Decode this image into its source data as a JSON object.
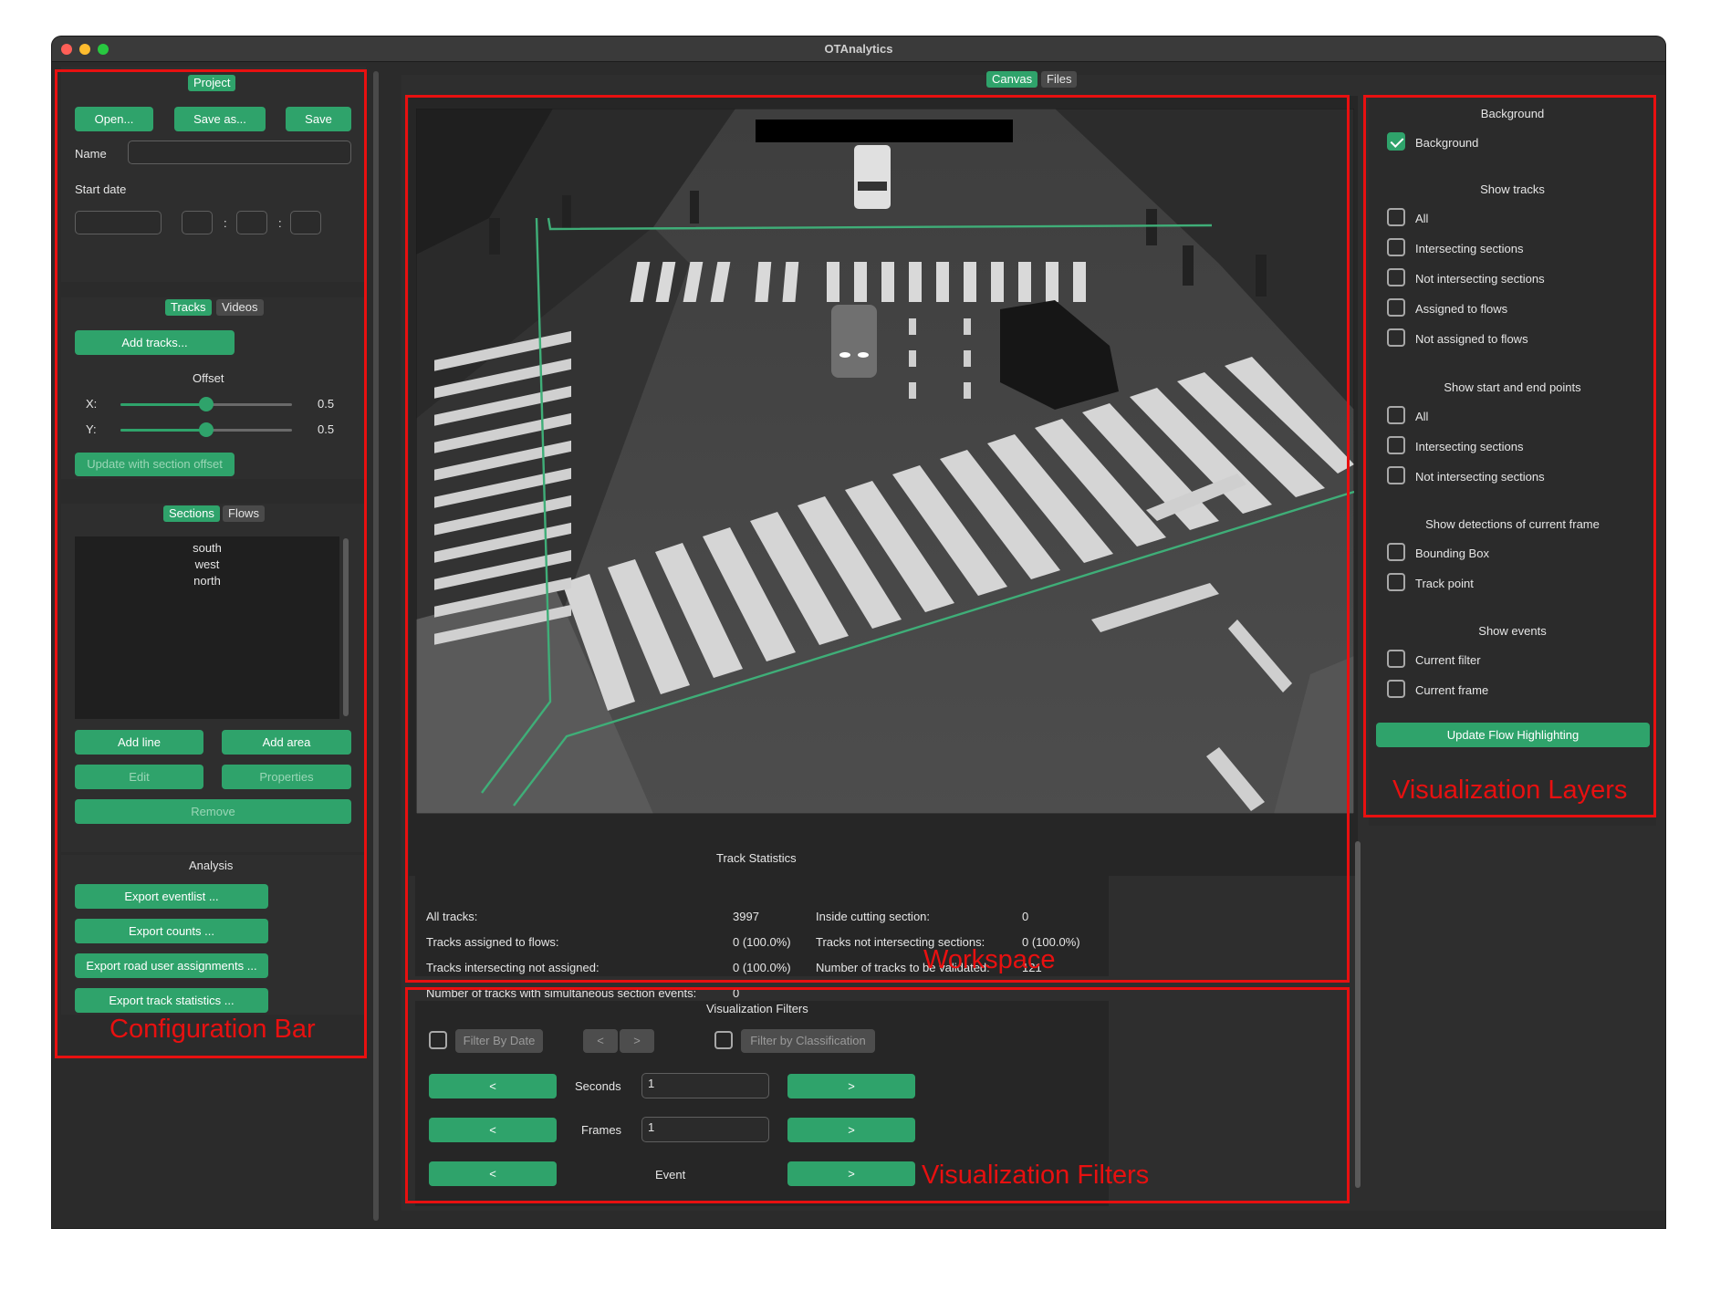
{
  "window": {
    "title": "OTAnalytics"
  },
  "config": {
    "project_tab": "Project",
    "open": "Open...",
    "save_as": "Save as...",
    "save": "Save",
    "name_label": "Name",
    "name_value": "",
    "start_date_label": "Start date",
    "time_sep1": ":",
    "time_sep2": ":",
    "tracks_tab": "Tracks",
    "videos_tab": "Videos",
    "add_tracks": "Add tracks...",
    "offset_label": "Offset",
    "x_label": "X:",
    "x_value": "0.5",
    "y_label": "Y:",
    "y_value": "0.5",
    "update_offset": "Update with section offset",
    "sections_tab": "Sections",
    "flows_tab": "Flows",
    "sections": [
      "south",
      "west",
      "north"
    ],
    "add_line": "Add line",
    "add_area": "Add area",
    "edit": "Edit",
    "properties": "Properties",
    "remove": "Remove",
    "analysis_title": "Analysis",
    "export_eventlist": "Export eventlist ...",
    "export_counts": "Export counts ...",
    "export_assignments": "Export road user assignments ...",
    "export_track_stats": "Export track statistics ..."
  },
  "workspace": {
    "canvas_tab": "Canvas",
    "files_tab": "Files",
    "stats_title": "Track Statistics",
    "stats_left": [
      {
        "label": "All tracks:",
        "value": "3997"
      },
      {
        "label": "Tracks assigned to flows:",
        "value": "0 (100.0%)"
      },
      {
        "label": "Tracks intersecting not assigned:",
        "value": "0 (100.0%)"
      },
      {
        "label": "Number of tracks with simultaneous section events:",
        "value": "0"
      }
    ],
    "stats_right": [
      {
        "label": "Inside cutting section:",
        "value": "0"
      },
      {
        "label": "Tracks not intersecting sections:",
        "value": "0 (100.0%)"
      },
      {
        "label": "Number of tracks to be validated:",
        "value": "121"
      }
    ]
  },
  "filters": {
    "title": "Visualization Filters",
    "filter_by_date": "Filter By Date",
    "prev_small": "<",
    "next_small": ">",
    "filter_by_classification": "Filter by Classification",
    "seconds_label": "Seconds",
    "seconds_value": "1",
    "frames_label": "Frames",
    "frames_value": "1",
    "event_label": "Event",
    "prev": "<",
    "next": ">"
  },
  "layers": {
    "background_title": "Background",
    "background_cb": "Background",
    "show_tracks_title": "Show tracks",
    "tracks": [
      "All",
      "Intersecting sections",
      "Not intersecting sections",
      "Assigned to flows",
      "Not assigned to flows"
    ],
    "start_end_title": "Show start and end points",
    "start_end": [
      "All",
      "Intersecting sections",
      "Not intersecting sections"
    ],
    "detections_title": "Show detections of current frame",
    "detections": [
      "Bounding Box",
      "Track point"
    ],
    "events_title": "Show events",
    "events": [
      "Current filter",
      "Current frame"
    ],
    "update_flow": "Update Flow Highlighting"
  },
  "annotations": {
    "config_bar": "Configuration Bar",
    "workspace": "Workspace",
    "viz_filters": "Visualization Filters",
    "viz_layers": "Visualization Layers"
  },
  "colors": {
    "accent": "#2fa36b",
    "annotation": "#e81010",
    "section_line": "#3fae78"
  }
}
